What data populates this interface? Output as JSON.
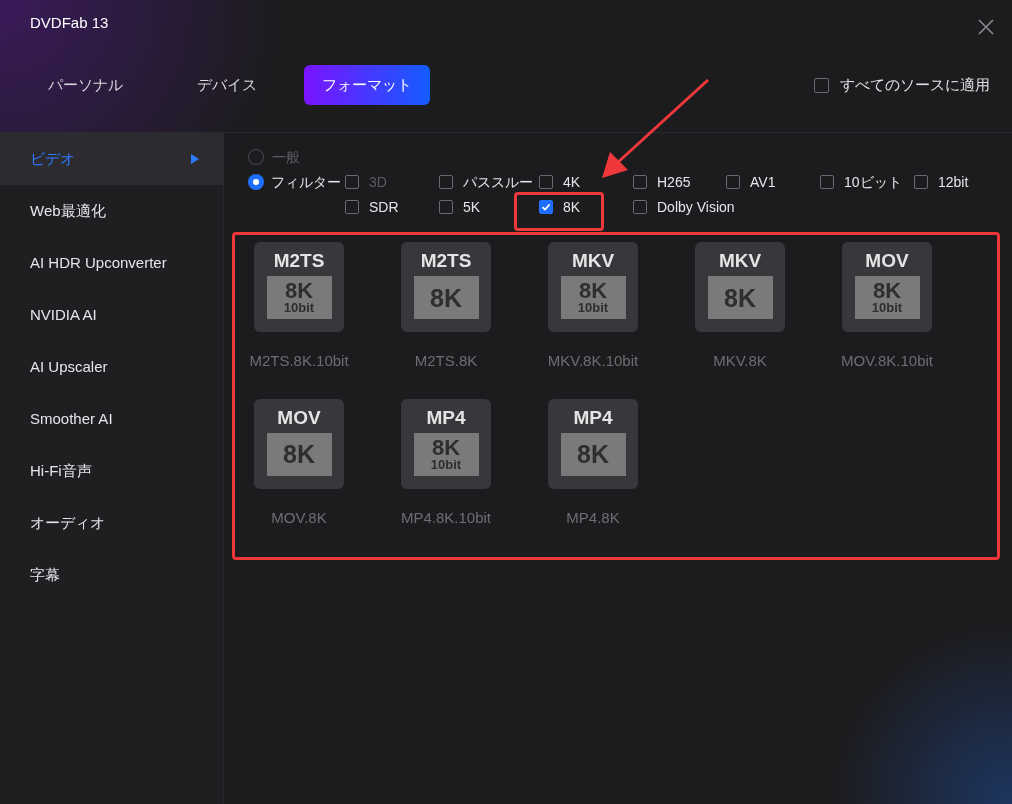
{
  "window": {
    "title": "DVDFab 13"
  },
  "tabs": [
    {
      "label": "パーソナル",
      "selected": false
    },
    {
      "label": "デバイス",
      "selected": false
    },
    {
      "label": "フォーマット",
      "selected": true
    }
  ],
  "apply_all": {
    "label": "すべてのソースに適用",
    "checked": false
  },
  "sidebar": {
    "items": [
      {
        "label": "ビデオ",
        "selected": true
      },
      {
        "label": "Web最適化",
        "selected": false
      },
      {
        "label": "AI HDR Upconverter",
        "selected": false
      },
      {
        "label": "NVIDIA AI",
        "selected": false
      },
      {
        "label": "AI Upscaler",
        "selected": false
      },
      {
        "label": "Smoother AI",
        "selected": false
      },
      {
        "label": "Hi-Fi音声",
        "selected": false
      },
      {
        "label": "オーディオ",
        "selected": false
      },
      {
        "label": "字幕",
        "selected": false
      }
    ]
  },
  "modes": [
    {
      "label": "一般",
      "selected": false,
      "disabled": true
    },
    {
      "label": "フィルター",
      "selected": true,
      "disabled": false
    }
  ],
  "filters": [
    [
      {
        "label": "3D",
        "checked": false,
        "disabled": true
      },
      {
        "label": "パススルー",
        "checked": false,
        "disabled": false
      },
      {
        "label": "4K",
        "checked": false,
        "disabled": false
      },
      {
        "label": "H265",
        "checked": false,
        "disabled": false
      },
      {
        "label": "AV1",
        "checked": false,
        "disabled": false
      },
      {
        "label": "10ビット",
        "checked": false,
        "disabled": false
      },
      {
        "label": "12bit",
        "checked": false,
        "disabled": false
      }
    ],
    [
      {
        "label": "SDR",
        "checked": false,
        "disabled": false
      },
      {
        "label": "5K",
        "checked": false,
        "disabled": false
      },
      {
        "label": "8K",
        "checked": true,
        "disabled": false
      },
      {
        "label": "Dolby Vision",
        "checked": false,
        "disabled": false
      }
    ]
  ],
  "formats": [
    {
      "container": "M2TS",
      "resolution": "8K",
      "depth": "10bit",
      "label": "M2TS.8K.10bit"
    },
    {
      "container": "M2TS",
      "resolution": "8K",
      "label": "M2TS.8K"
    },
    {
      "container": "MKV",
      "resolution": "8K",
      "depth": "10bit",
      "label": "MKV.8K.10bit"
    },
    {
      "container": "MKV",
      "resolution": "8K",
      "label": "MKV.8K"
    },
    {
      "container": "MOV",
      "resolution": "8K",
      "depth": "10bit",
      "label": "MOV.8K.10bit"
    },
    {
      "container": "MOV",
      "resolution": "8K",
      "label": "MOV.8K"
    },
    {
      "container": "MP4",
      "resolution": "8K",
      "depth": "10bit",
      "label": "MP4.8K.10bit"
    },
    {
      "container": "MP4",
      "resolution": "8K",
      "label": "MP4.8K"
    }
  ]
}
